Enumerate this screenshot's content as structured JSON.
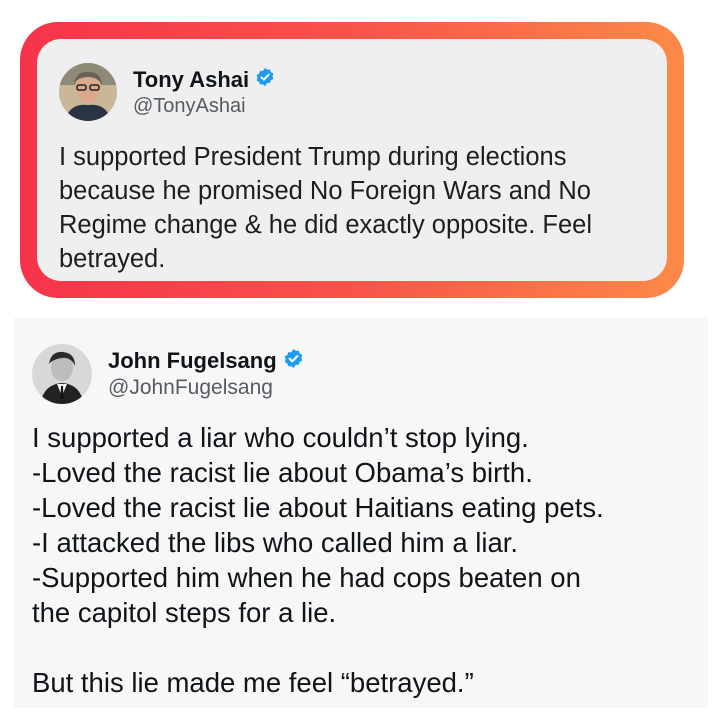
{
  "quoted_tweet": {
    "display_name": "Tony Ashai",
    "handle": "@TonyAshai",
    "verified": true,
    "avatar_icon": "user-photo-avatar",
    "text_lines": [
      "I supported President Trump during elections",
      "because he promised No Foreign Wars and No",
      "Regime change & he did exactly opposite. Feel",
      "betrayed."
    ]
  },
  "main_tweet": {
    "display_name": "John Fugelsang",
    "handle": "@JohnFugelsang",
    "verified": true,
    "avatar_icon": "user-photo-avatar",
    "text_lines": [
      "I supported a liar who couldn’t stop lying.",
      "-Loved the racist lie about Obama’s birth.",
      "-Loved the racist lie about Haitians eating pets.",
      "-I attacked the libs who called him a liar.",
      "-Supported him when he had cops beaten on",
      "the capitol steps for a lie."
    ],
    "closing_line": "But this lie made me feel “betrayed.”"
  },
  "colors": {
    "frame_gradient_start": "#f6334a",
    "frame_gradient_end": "#fb8a48",
    "verified_badge": "#1d9bf0",
    "quote_card_bg": "#efefef"
  }
}
